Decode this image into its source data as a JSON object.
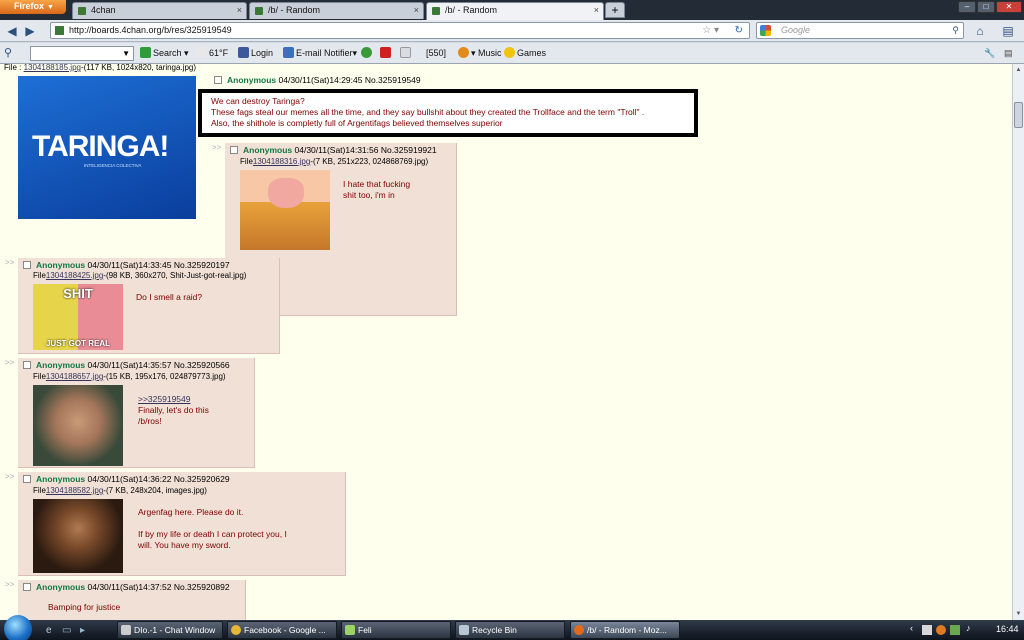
{
  "browser": {
    "app_button": "Firefox",
    "tabs": [
      {
        "label": "4chan"
      },
      {
        "label": "/b/ - Random"
      },
      {
        "label": "/b/ - Random"
      }
    ],
    "url": "http://boards.4chan.org/b/res/325919549",
    "search_placeholder": "Google"
  },
  "toolbar": {
    "search": "Search",
    "weather": "61°F",
    "login": "Login",
    "email": "E-mail Notifier",
    "count": "[550]",
    "music": "Music",
    "games": "Games"
  },
  "thread": {
    "op": {
      "file_prefix": "File :",
      "file_link": "1304188185.jpg",
      "file_info": "-(117 KB, 1024x820, taringa.jpg)",
      "name": "Anonymous",
      "meta": "04/30/11(Sat)14:29:45 No.325919549",
      "image_text": "TARINGA!",
      "image_sub": "INTELIGENCIA COLECTIVA",
      "lines": [
        "We can destroy Taringa?",
        "These fags steal our memes all the time, and they say bullshit about they created the Trollface and the term \"Troll\" .",
        "Also, the shithole is completly full of Argentifags believed themselves superior"
      ]
    },
    "replies": [
      {
        "name": "Anonymous",
        "meta": "04/30/11(Sat)14:31:56 No.325919921",
        "file_prefix": "File",
        "file_link": "1304188316.jpg",
        "file_info": "-(7 KB, 251x223, 024868769.jpg)",
        "lines": [
          "I hate that fucking",
          "shit too, i'm in"
        ]
      },
      {
        "name": "Anonymous",
        "meta": "04/30/11(Sat)14:33:45 No.325920197",
        "file_prefix": "File",
        "file_link": "1304188425.jpg",
        "file_info": "-(98 KB, 360x270, Shit-Just-got-real.jpg)",
        "img_top": "SHIT",
        "img_bottom": "JUST GOT REAL",
        "lines": [
          "Do I smell a raid?"
        ]
      },
      {
        "name": "Anonymous",
        "meta": "04/30/11(Sat)14:35:57 No.325920566",
        "file_prefix": "File",
        "file_link": "1304188657.jpg",
        "file_info": "-(15 KB, 195x176, 024879773.jpg)",
        "quote": ">>325919549",
        "lines": [
          "Finally, let's do this",
          "/b/ros!"
        ]
      },
      {
        "name": "Anonymous",
        "meta": "04/30/11(Sat)14:36:22 No.325920629",
        "file_prefix": "File",
        "file_link": "1304188582.jpg",
        "file_info": "-(7 KB, 248x204, images.jpg)",
        "lines": [
          "Argenfag here. Please do it.",
          "",
          "If by my life or death I can protect you, I",
          "will. You have my sword."
        ]
      },
      {
        "name": "Anonymous",
        "meta": "04/30/11(Sat)14:37:52 No.325920892",
        "lines": [
          "Bamping for justice"
        ]
      }
    ],
    "arrows": ">>"
  },
  "taskbar": {
    "items": [
      {
        "label": "DIo.-1 - Chat Window"
      },
      {
        "label": "Facebook - Google ..."
      },
      {
        "label": "Feli"
      },
      {
        "label": "Recycle Bin"
      },
      {
        "label": "/b/ - Random - Moz..."
      }
    ],
    "clock": "16:44"
  },
  "colors": {
    "name_green": "#117743",
    "post_bg": "#f0e0d6",
    "page_bg": "#ffffee",
    "quote_text": "#800000"
  }
}
